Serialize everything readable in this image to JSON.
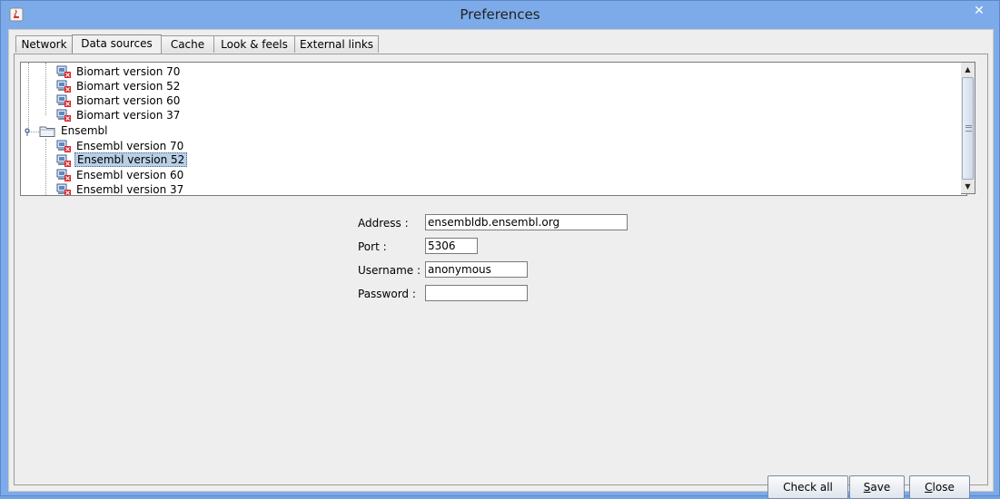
{
  "window": {
    "title": "Preferences",
    "close_symbol": "✕"
  },
  "tabs": [
    {
      "label": "Network"
    },
    {
      "label": "Data sources"
    },
    {
      "label": "Cache"
    },
    {
      "label": "Look & feels"
    },
    {
      "label": "External links"
    }
  ],
  "active_tab": "Data sources",
  "tree": {
    "items": [
      {
        "label": "Biomart version 70",
        "type": "database"
      },
      {
        "label": "Biomart version 52",
        "type": "database"
      },
      {
        "label": "Biomart version 60",
        "type": "database"
      },
      {
        "label": "Biomart version 37",
        "type": "database"
      },
      {
        "label": "Ensembl",
        "type": "folder"
      },
      {
        "label": "Ensembl version 70",
        "type": "database"
      },
      {
        "label": "Ensembl version 52",
        "type": "database",
        "selected": true
      },
      {
        "label": "Ensembl version 60",
        "type": "database"
      },
      {
        "label": "Ensembl version 37",
        "type": "database"
      }
    ]
  },
  "form": {
    "address_label": "Address :",
    "address_value": "ensembldb.ensembl.org",
    "port_label": "Port :",
    "port_value": "5306",
    "username_label": "Username :",
    "username_value": "anonymous",
    "password_label": "Password :",
    "password_value": ""
  },
  "buttons": {
    "check_all": "Check all",
    "save_first": "S",
    "save_rest": "ave",
    "close_first": "C",
    "close_rest": "lose"
  },
  "colors": {
    "selection": "#b8cfe5",
    "window_frame": "#7dabe9",
    "error_badge": "#d9262b"
  }
}
